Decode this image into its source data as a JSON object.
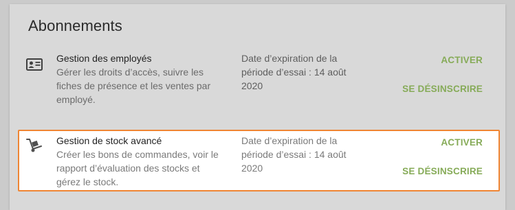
{
  "section": {
    "title": "Abonnements"
  },
  "subscriptions": [
    {
      "icon": "id-card-icon",
      "name": "Gestion des employés",
      "description_lines": [
        "Gérer les droits d’accès, suivre les",
        "fiches de présence et les ventes par",
        "employé."
      ],
      "expiration_lines": [
        "Date d’expiration de la",
        "période d’essai : 14 août",
        "2020"
      ],
      "activate_label": "ACTIVER",
      "unsubscribe_label": "SE DÉSINSCRIRE"
    },
    {
      "icon": "hand-truck-icon",
      "name": "Gestion de stock avancé",
      "description_lines": [
        "Créer les bons de commandes, voir le",
        "rapport d’évaluation des stocks et",
        "gérez le stock."
      ],
      "expiration_lines": [
        "Date d’expiration de la",
        "période d’essai : 14 août",
        "2020"
      ],
      "activate_label": "ACTIVER",
      "unsubscribe_label": "SE DÉSINSCRIRE",
      "highlighted": true
    }
  ],
  "colors": {
    "accent": "#86ab58",
    "highlight_border": "#ef8533"
  }
}
